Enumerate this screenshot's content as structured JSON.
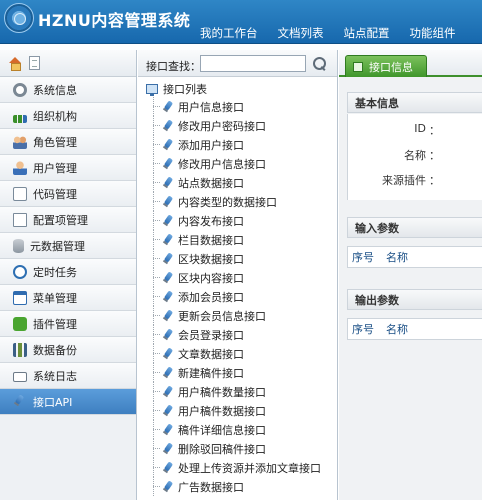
{
  "app": {
    "title": "HZNU内容管理系统"
  },
  "topnav": [
    "我的工作台",
    "文档列表",
    "站点配置",
    "功能组件"
  ],
  "sidebar": {
    "items": [
      {
        "label": "系统信息",
        "icon": "gear-icon"
      },
      {
        "label": "组织机构",
        "icon": "org-chart-icon"
      },
      {
        "label": "角色管理",
        "icon": "users-icon"
      },
      {
        "label": "用户管理",
        "icon": "user-icon"
      },
      {
        "label": "代码管理",
        "icon": "code-icon"
      },
      {
        "label": "配置项管理",
        "icon": "config-icon"
      },
      {
        "label": "元数据管理",
        "icon": "database-icon"
      },
      {
        "label": "定时任务",
        "icon": "clock-icon"
      },
      {
        "label": "菜单管理",
        "icon": "menu-icon"
      },
      {
        "label": "插件管理",
        "icon": "puzzle-icon"
      },
      {
        "label": "数据备份",
        "icon": "backup-icon"
      },
      {
        "label": "系统日志",
        "icon": "envelope-icon"
      },
      {
        "label": "接口API",
        "icon": "plug-icon",
        "active": true
      }
    ]
  },
  "search": {
    "label": "接口查找：",
    "value": ""
  },
  "tree": {
    "root": "接口列表",
    "items": [
      "用户信息接口",
      "修改用户密码接口",
      "添加用户接口",
      "修改用户信息接口",
      "站点数据接口",
      "内容类型的数据接口",
      "内容发布接口",
      "栏目数据接口",
      "区块数据接口",
      "区块内容接口",
      "添加会员接口",
      "更新会员信息接口",
      "会员登录接口",
      "文章数据接口",
      "新建稿件接口",
      "用户稿件数量接口",
      "用户稿件数据接口",
      "稿件详细信息接口",
      "删除驳回稿件接口",
      "处理上传资源并添加文章接口",
      "广告数据接口"
    ]
  },
  "detail": {
    "tab_label": "接口信息",
    "basic": {
      "title": "基本信息",
      "fields": [
        "ID",
        "名称",
        "来源插件"
      ]
    },
    "input": {
      "title": "输入参数",
      "columns": [
        "序号",
        "名称"
      ]
    },
    "output": {
      "title": "输出参数",
      "columns": [
        "序号",
        "名称"
      ]
    }
  },
  "colors": {
    "header": "#1e73b8",
    "active_menu": "#4a8ccc",
    "tab_green": "#4a9e33"
  }
}
